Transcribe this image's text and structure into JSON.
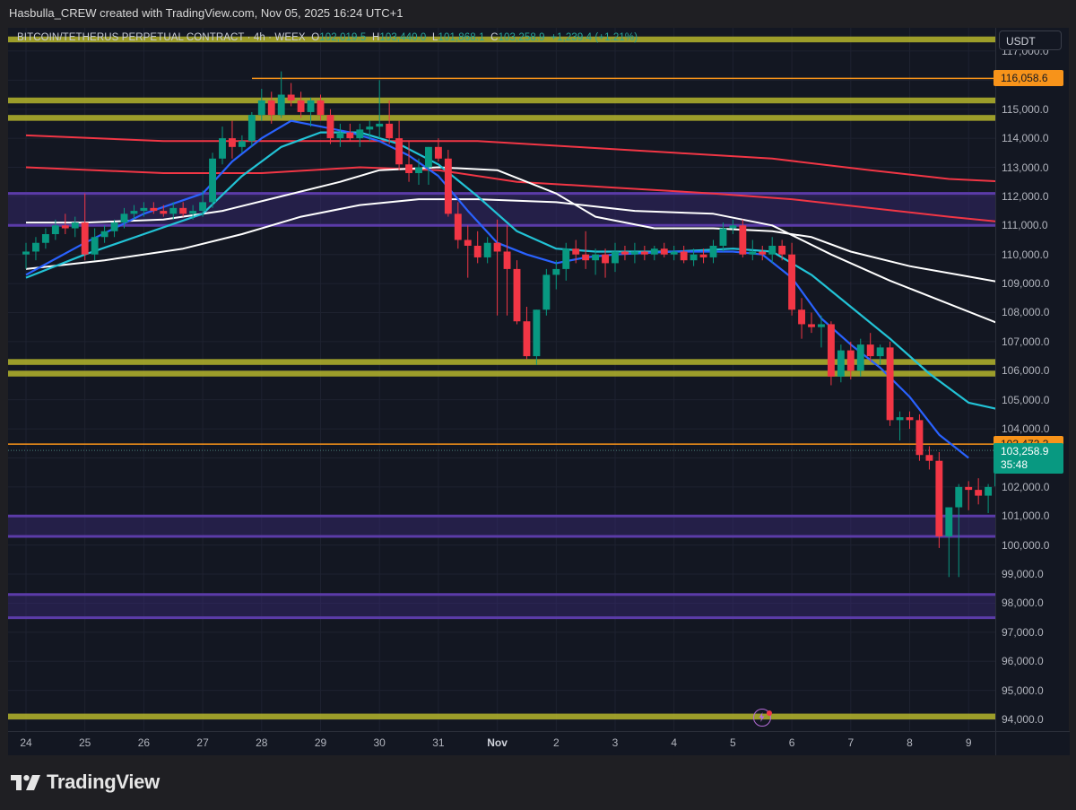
{
  "header": {
    "attribution": "Hasbulla_CREW created with TradingView.com, Nov 05, 2025 16:24 UTC+1"
  },
  "legend": {
    "symbol": "BITCOIN/TETHERUS PERPETUAL CONTRACT · 4h · WEEX",
    "o_label": "O",
    "o_value": "102,019.5",
    "h_label": "H",
    "h_value": "103,440.0",
    "l_label": "L",
    "l_value": "101,868.1",
    "c_label": "C",
    "c_value": "103,258.9",
    "change": "+1,239.4 (+1.21%)"
  },
  "currency": "USDT",
  "badges": {
    "upper_level": "116,058.6",
    "resistance_level": "103,473.3",
    "last_price": "103,258.9",
    "countdown": "35:48"
  },
  "footer": {
    "brand": "TradingView"
  },
  "colors": {
    "up": "#089981",
    "down": "#f23645",
    "ema_fast": "#2962ff",
    "ema_mid": "#22c3d6",
    "ema_slow": "#ffffff",
    "ema_long": "#f23645",
    "orange_line": "#f7931a",
    "yellow_zone": "#b5b52b",
    "purple_zone": "#5b3ba8"
  },
  "chart_data": {
    "type": "candlestick",
    "symbol": "BITCOIN/TETHERUS PERPETUAL CONTRACT",
    "interval": "4h",
    "exchange": "WEEX",
    "ylim": [
      93600,
      117800
    ],
    "y_ticks": [
      117000,
      116000,
      115000,
      114000,
      113000,
      112000,
      111000,
      110000,
      109000,
      108000,
      107000,
      106000,
      105000,
      104000,
      103000,
      102000,
      101000,
      100000,
      99000,
      98000,
      97000,
      96000,
      95000,
      94000
    ],
    "x_axis": {
      "labels": [
        "24",
        "25",
        "26",
        "27",
        "28",
        "29",
        "30",
        "31",
        "Nov",
        "2",
        "3",
        "4",
        "5",
        "6",
        "7",
        "8",
        "9"
      ],
      "start_day": 24,
      "bars_per_day": 6
    },
    "candles": [
      {
        "o": 110000,
        "h": 110400,
        "l": 109500,
        "c": 110100
      },
      {
        "o": 110100,
        "h": 110600,
        "l": 109800,
        "c": 110400
      },
      {
        "o": 110400,
        "h": 110900,
        "l": 110200,
        "c": 110700
      },
      {
        "o": 110700,
        "h": 111200,
        "l": 110500,
        "c": 111000
      },
      {
        "o": 111000,
        "h": 111400,
        "l": 110700,
        "c": 110900
      },
      {
        "o": 110900,
        "h": 111300,
        "l": 110600,
        "c": 111100
      },
      {
        "o": 111100,
        "h": 112100,
        "l": 109800,
        "c": 110000
      },
      {
        "o": 110000,
        "h": 110900,
        "l": 109800,
        "c": 110600
      },
      {
        "o": 110600,
        "h": 111000,
        "l": 110400,
        "c": 110800
      },
      {
        "o": 110800,
        "h": 111200,
        "l": 110600,
        "c": 111100
      },
      {
        "o": 111100,
        "h": 111600,
        "l": 110900,
        "c": 111400
      },
      {
        "o": 111400,
        "h": 111700,
        "l": 111200,
        "c": 111500
      },
      {
        "o": 111500,
        "h": 111800,
        "l": 111300,
        "c": 111600
      },
      {
        "o": 111600,
        "h": 111800,
        "l": 111400,
        "c": 111500
      },
      {
        "o": 111500,
        "h": 111700,
        "l": 111300,
        "c": 111400
      },
      {
        "o": 111400,
        "h": 111800,
        "l": 111200,
        "c": 111600
      },
      {
        "o": 111600,
        "h": 111800,
        "l": 111300,
        "c": 111400
      },
      {
        "o": 111400,
        "h": 111700,
        "l": 111200,
        "c": 111500
      },
      {
        "o": 111500,
        "h": 112200,
        "l": 111300,
        "c": 111800
      },
      {
        "o": 111800,
        "h": 113500,
        "l": 111600,
        "c": 113300
      },
      {
        "o": 113300,
        "h": 114400,
        "l": 113100,
        "c": 114000
      },
      {
        "o": 114000,
        "h": 114600,
        "l": 113300,
        "c": 113700
      },
      {
        "o": 113700,
        "h": 114100,
        "l": 113500,
        "c": 113900
      },
      {
        "o": 113900,
        "h": 114900,
        "l": 113700,
        "c": 114800
      },
      {
        "o": 114800,
        "h": 115700,
        "l": 114600,
        "c": 115300
      },
      {
        "o": 115300,
        "h": 115600,
        "l": 114500,
        "c": 114800
      },
      {
        "o": 114800,
        "h": 116300,
        "l": 114700,
        "c": 115500
      },
      {
        "o": 115500,
        "h": 115900,
        "l": 115100,
        "c": 115300
      },
      {
        "o": 115300,
        "h": 115600,
        "l": 114700,
        "c": 114900
      },
      {
        "o": 114900,
        "h": 115400,
        "l": 114400,
        "c": 115300
      },
      {
        "o": 115300,
        "h": 115500,
        "l": 114600,
        "c": 114800
      },
      {
        "o": 114800,
        "h": 115000,
        "l": 113800,
        "c": 114000
      },
      {
        "o": 114000,
        "h": 114500,
        "l": 113700,
        "c": 114200
      },
      {
        "o": 114200,
        "h": 114500,
        "l": 113900,
        "c": 114000
      },
      {
        "o": 114000,
        "h": 114500,
        "l": 113700,
        "c": 114300
      },
      {
        "o": 114300,
        "h": 114600,
        "l": 113900,
        "c": 114400
      },
      {
        "o": 114400,
        "h": 116000,
        "l": 114000,
        "c": 114500
      },
      {
        "o": 114500,
        "h": 115300,
        "l": 113800,
        "c": 114000
      },
      {
        "o": 114000,
        "h": 114600,
        "l": 112900,
        "c": 113100
      },
      {
        "o": 113100,
        "h": 113900,
        "l": 112500,
        "c": 112800
      },
      {
        "o": 112800,
        "h": 113300,
        "l": 112400,
        "c": 113000
      },
      {
        "o": 113000,
        "h": 113700,
        "l": 112400,
        "c": 113700
      },
      {
        "o": 113700,
        "h": 114000,
        "l": 113200,
        "c": 113300
      },
      {
        "o": 113300,
        "h": 113600,
        "l": 111300,
        "c": 111400
      },
      {
        "o": 111400,
        "h": 111800,
        "l": 110200,
        "c": 110500
      },
      {
        "o": 110500,
        "h": 111000,
        "l": 109200,
        "c": 110300
      },
      {
        "o": 110300,
        "h": 110800,
        "l": 109700,
        "c": 109900
      },
      {
        "o": 109900,
        "h": 110600,
        "l": 109700,
        "c": 110400
      },
      {
        "o": 110400,
        "h": 111200,
        "l": 107900,
        "c": 110100
      },
      {
        "o": 110100,
        "h": 111000,
        "l": 107900,
        "c": 109500
      },
      {
        "o": 109500,
        "h": 109800,
        "l": 107600,
        "c": 107700
      },
      {
        "o": 107700,
        "h": 108200,
        "l": 106400,
        "c": 106500
      },
      {
        "o": 106500,
        "h": 108100,
        "l": 106200,
        "c": 108100
      },
      {
        "o": 108100,
        "h": 109500,
        "l": 107900,
        "c": 109300
      },
      {
        "o": 109300,
        "h": 109800,
        "l": 108800,
        "c": 109500
      },
      {
        "o": 109500,
        "h": 110400,
        "l": 109100,
        "c": 110200
      },
      {
        "o": 110200,
        "h": 110500,
        "l": 109700,
        "c": 110000
      },
      {
        "o": 110000,
        "h": 110800,
        "l": 109500,
        "c": 109800
      },
      {
        "o": 109800,
        "h": 110200,
        "l": 109300,
        "c": 110000
      },
      {
        "o": 110000,
        "h": 110200,
        "l": 109200,
        "c": 109700
      },
      {
        "o": 109700,
        "h": 110400,
        "l": 109400,
        "c": 110100
      },
      {
        "o": 110100,
        "h": 110300,
        "l": 109800,
        "c": 110000
      },
      {
        "o": 110000,
        "h": 110400,
        "l": 109700,
        "c": 110100
      },
      {
        "o": 110100,
        "h": 110300,
        "l": 109800,
        "c": 110000
      },
      {
        "o": 110000,
        "h": 110300,
        "l": 109800,
        "c": 110200
      },
      {
        "o": 110200,
        "h": 110400,
        "l": 109900,
        "c": 110000
      },
      {
        "o": 110000,
        "h": 110300,
        "l": 109800,
        "c": 110100
      },
      {
        "o": 110100,
        "h": 110300,
        "l": 109700,
        "c": 109800
      },
      {
        "o": 109800,
        "h": 110200,
        "l": 109600,
        "c": 110000
      },
      {
        "o": 110000,
        "h": 110200,
        "l": 109700,
        "c": 109900
      },
      {
        "o": 109900,
        "h": 110500,
        "l": 109700,
        "c": 110300
      },
      {
        "o": 110300,
        "h": 111100,
        "l": 110100,
        "c": 110900
      },
      {
        "o": 110900,
        "h": 111200,
        "l": 110700,
        "c": 111000
      },
      {
        "o": 111000,
        "h": 111200,
        "l": 109900,
        "c": 110000
      },
      {
        "o": 110000,
        "h": 110500,
        "l": 109800,
        "c": 110100
      },
      {
        "o": 110100,
        "h": 110300,
        "l": 109800,
        "c": 110000
      },
      {
        "o": 110000,
        "h": 110600,
        "l": 109700,
        "c": 110300
      },
      {
        "o": 110300,
        "h": 110500,
        "l": 109800,
        "c": 110000
      },
      {
        "o": 110000,
        "h": 110400,
        "l": 107900,
        "c": 108100
      },
      {
        "o": 108100,
        "h": 108500,
        "l": 107100,
        "c": 107600
      },
      {
        "o": 107600,
        "h": 108000,
        "l": 107300,
        "c": 107500
      },
      {
        "o": 107500,
        "h": 107900,
        "l": 106800,
        "c": 107600
      },
      {
        "o": 107600,
        "h": 107700,
        "l": 105500,
        "c": 105800
      },
      {
        "o": 105800,
        "h": 106900,
        "l": 105600,
        "c": 106700
      },
      {
        "o": 106700,
        "h": 107000,
        "l": 105700,
        "c": 106000
      },
      {
        "o": 106000,
        "h": 107100,
        "l": 105800,
        "c": 106900
      },
      {
        "o": 106900,
        "h": 107300,
        "l": 106300,
        "c": 106500
      },
      {
        "o": 106500,
        "h": 106900,
        "l": 106200,
        "c": 106800
      },
      {
        "o": 106800,
        "h": 107000,
        "l": 104100,
        "c": 104300
      },
      {
        "o": 104300,
        "h": 104600,
        "l": 103600,
        "c": 104400
      },
      {
        "o": 104400,
        "h": 104600,
        "l": 104000,
        "c": 104300
      },
      {
        "o": 104300,
        "h": 104500,
        "l": 102900,
        "c": 103100
      },
      {
        "o": 103100,
        "h": 103400,
        "l": 102600,
        "c": 102900
      },
      {
        "o": 102900,
        "h": 103200,
        "l": 99900,
        "c": 100300
      },
      {
        "o": 100300,
        "h": 101200,
        "l": 98900,
        "c": 101300
      },
      {
        "o": 101300,
        "h": 102100,
        "l": 98900,
        "c": 102000
      },
      {
        "o": 102000,
        "h": 102200,
        "l": 101200,
        "c": 101900
      },
      {
        "o": 101900,
        "h": 102300,
        "l": 101400,
        "c": 101700
      },
      {
        "o": 101700,
        "h": 102100,
        "l": 101100,
        "c": 102000
      },
      {
        "o": 102019.5,
        "h": 103440,
        "l": 101868.1,
        "c": 103258.9
      }
    ],
    "ema_fast": [
      [
        0,
        109300
      ],
      [
        6,
        110400
      ],
      [
        12,
        111400
      ],
      [
        18,
        112100
      ],
      [
        21,
        113200
      ],
      [
        24,
        114000
      ],
      [
        27,
        114600
      ],
      [
        30,
        114400
      ],
      [
        33,
        114200
      ],
      [
        36,
        113900
      ],
      [
        39,
        113400
      ],
      [
        42,
        112700
      ],
      [
        45,
        111500
      ],
      [
        48,
        110400
      ],
      [
        51,
        110000
      ],
      [
        54,
        109700
      ],
      [
        57,
        109900
      ],
      [
        60,
        110000
      ],
      [
        66,
        110100
      ],
      [
        72,
        110100
      ],
      [
        75,
        110000
      ],
      [
        78,
        109200
      ],
      [
        81,
        107800
      ],
      [
        84,
        106900
      ],
      [
        87,
        106100
      ],
      [
        90,
        105100
      ],
      [
        93,
        103800
      ],
      [
        96,
        103000
      ]
    ],
    "ema_mid": [
      [
        0,
        109200
      ],
      [
        6,
        110000
      ],
      [
        12,
        110700
      ],
      [
        18,
        111400
      ],
      [
        22,
        112700
      ],
      [
        26,
        113700
      ],
      [
        30,
        114200
      ],
      [
        34,
        114200
      ],
      [
        38,
        113800
      ],
      [
        42,
        113100
      ],
      [
        46,
        112000
      ],
      [
        50,
        110800
      ],
      [
        54,
        110200
      ],
      [
        58,
        110100
      ],
      [
        66,
        110100
      ],
      [
        72,
        110200
      ],
      [
        76,
        110100
      ],
      [
        80,
        109300
      ],
      [
        84,
        108200
      ],
      [
        88,
        107100
      ],
      [
        92,
        105900
      ],
      [
        96,
        104900
      ],
      [
        100,
        104600
      ]
    ],
    "ema_slow": [
      [
        0,
        111100
      ],
      [
        6,
        111100
      ],
      [
        14,
        111200
      ],
      [
        20,
        111500
      ],
      [
        26,
        112000
      ],
      [
        32,
        112500
      ],
      [
        36,
        112900
      ],
      [
        42,
        113000
      ],
      [
        48,
        112900
      ],
      [
        54,
        112100
      ],
      [
        58,
        111300
      ],
      [
        64,
        110900
      ],
      [
        70,
        110900
      ],
      [
        76,
        110800
      ],
      [
        80,
        110600
      ],
      [
        84,
        110100
      ],
      [
        90,
        109600
      ],
      [
        95,
        109300
      ],
      [
        100,
        109000
      ]
    ],
    "ema_slow2": [
      [
        0,
        109500
      ],
      [
        8,
        109800
      ],
      [
        16,
        110200
      ],
      [
        22,
        110700
      ],
      [
        28,
        111300
      ],
      [
        34,
        111700
      ],
      [
        40,
        111900
      ],
      [
        46,
        111900
      ],
      [
        54,
        111800
      ],
      [
        62,
        111500
      ],
      [
        70,
        111400
      ],
      [
        76,
        111000
      ],
      [
        82,
        110000
      ],
      [
        88,
        109100
      ],
      [
        94,
        108300
      ],
      [
        100,
        107500
      ]
    ],
    "ema_long": [
      [
        0,
        114100
      ],
      [
        14,
        113900
      ],
      [
        28,
        113900
      ],
      [
        36,
        113900
      ],
      [
        46,
        113900
      ],
      [
        56,
        113700
      ],
      [
        66,
        113500
      ],
      [
        76,
        113300
      ],
      [
        86,
        112900
      ],
      [
        94,
        112600
      ],
      [
        100,
        112500
      ]
    ],
    "ema_long2": [
      [
        0,
        113000
      ],
      [
        14,
        112800
      ],
      [
        24,
        112800
      ],
      [
        34,
        113000
      ],
      [
        42,
        112900
      ],
      [
        50,
        112500
      ],
      [
        60,
        112300
      ],
      [
        70,
        112100
      ],
      [
        78,
        111900
      ],
      [
        86,
        111600
      ],
      [
        94,
        111300
      ],
      [
        100,
        111100
      ]
    ],
    "levels": {
      "orange_lines": [
        116058.6,
        103473.3
      ],
      "last_price": 103258.9,
      "yellow_zones": [
        [
          117500,
          117300
        ],
        [
          115400,
          115200
        ],
        [
          114800,
          114600
        ],
        [
          106400,
          106200
        ],
        [
          106000,
          105800
        ],
        [
          94200,
          94000
        ]
      ],
      "purple_zones": [
        [
          112100,
          111000
        ],
        [
          101000,
          100300
        ],
        [
          98300,
          97500
        ]
      ]
    }
  }
}
